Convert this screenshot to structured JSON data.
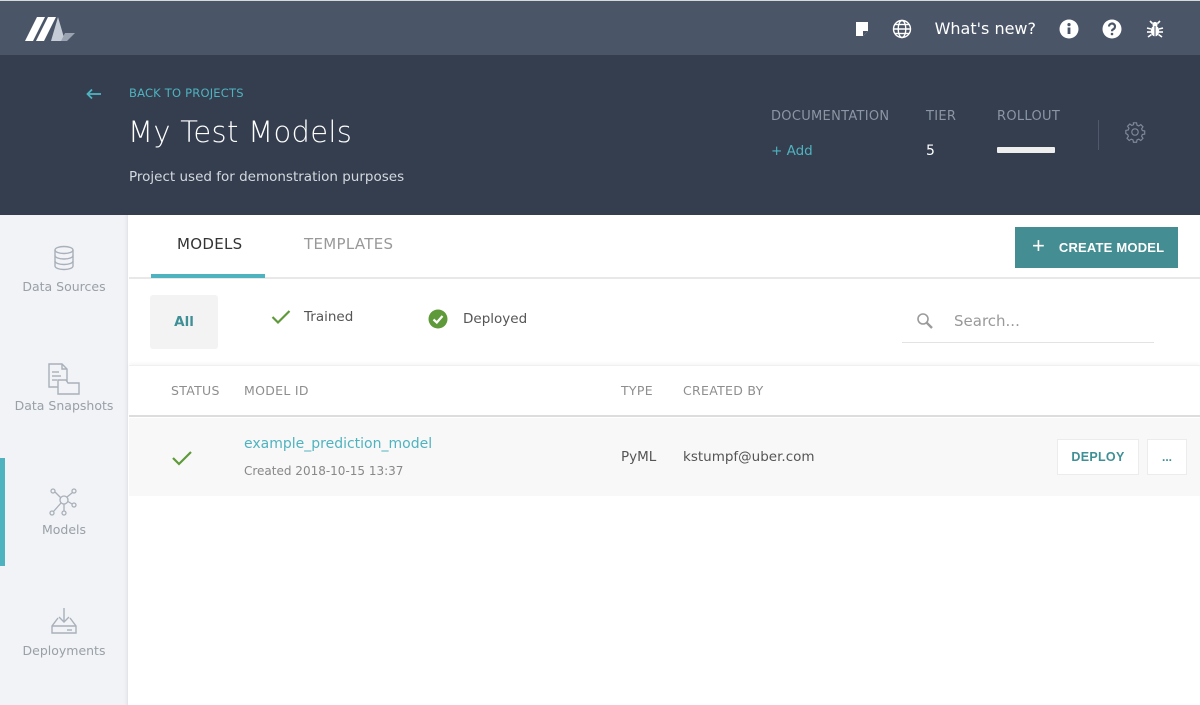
{
  "topbar": {
    "logo": "michelangelo-logo",
    "icons": [
      "note-icon",
      "globe-icon"
    ],
    "whats_new": "What's new?",
    "right_icons": [
      "info-icon",
      "help-icon",
      "bug-icon"
    ]
  },
  "header": {
    "back_label": "BACK TO PROJECTS",
    "title": "My Test Models",
    "description": "Project used for demonstration purposes",
    "documentation_label": "DOCUMENTATION",
    "documentation_action": "+ Add",
    "tier_label": "TIER",
    "tier_value": "5",
    "rollout_label": "ROLLOUT",
    "rollout_fraction": 1.0,
    "accent_color": "#4fb3bf"
  },
  "sidebar": {
    "items": [
      {
        "label": "Data Sources",
        "icon": "database-icon"
      },
      {
        "label": "Data Snapshots",
        "icon": "snapshot-icon"
      },
      {
        "label": "Models",
        "icon": "network-icon",
        "active": true
      },
      {
        "label": "Deployments",
        "icon": "deploy-icon"
      }
    ]
  },
  "main": {
    "tabs": [
      {
        "label": "MODELS",
        "active": true
      },
      {
        "label": "TEMPLATES",
        "active": false
      }
    ],
    "create_button": "CREATE MODEL",
    "filters": {
      "all": "All",
      "trained": "Trained",
      "deployed": "Deployed"
    },
    "search_placeholder": "Search...",
    "table": {
      "columns": [
        "STATUS",
        "MODEL ID",
        "TYPE",
        "CREATED BY"
      ],
      "rows": [
        {
          "status": "trained",
          "model_id": "example_prediction_model",
          "created": "Created 2018-10-15 13:37",
          "type": "PyML",
          "created_by": "kstumpf@uber.com",
          "deploy_label": "DEPLOY",
          "more_label": "..."
        }
      ]
    }
  }
}
